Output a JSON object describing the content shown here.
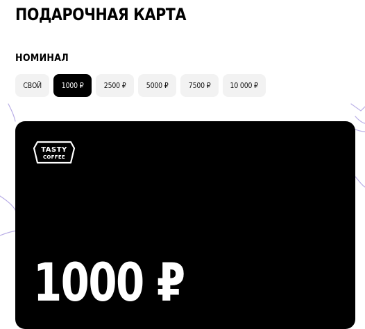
{
  "page": {
    "title": "ПОДАРОЧНАЯ КАРТА",
    "section_label": "НОМИНАЛ"
  },
  "denominations": [
    {
      "label": "СВОЙ",
      "selected": false
    },
    {
      "label": "1000 ₽",
      "selected": true
    },
    {
      "label": "2500 ₽",
      "selected": false
    },
    {
      "label": "5000 ₽",
      "selected": false
    },
    {
      "label": "7500 ₽",
      "selected": false
    },
    {
      "label": "10 000 ₽",
      "selected": false
    }
  ],
  "card": {
    "logo_line1": "TASTY",
    "logo_line2": "COFFEE",
    "amount": "1000 ₽"
  },
  "colors": {
    "chip_bg": "#f2f2f2",
    "chip_active_bg": "#000000",
    "card_bg": "#000000",
    "decor_line": "#b9aee6"
  }
}
